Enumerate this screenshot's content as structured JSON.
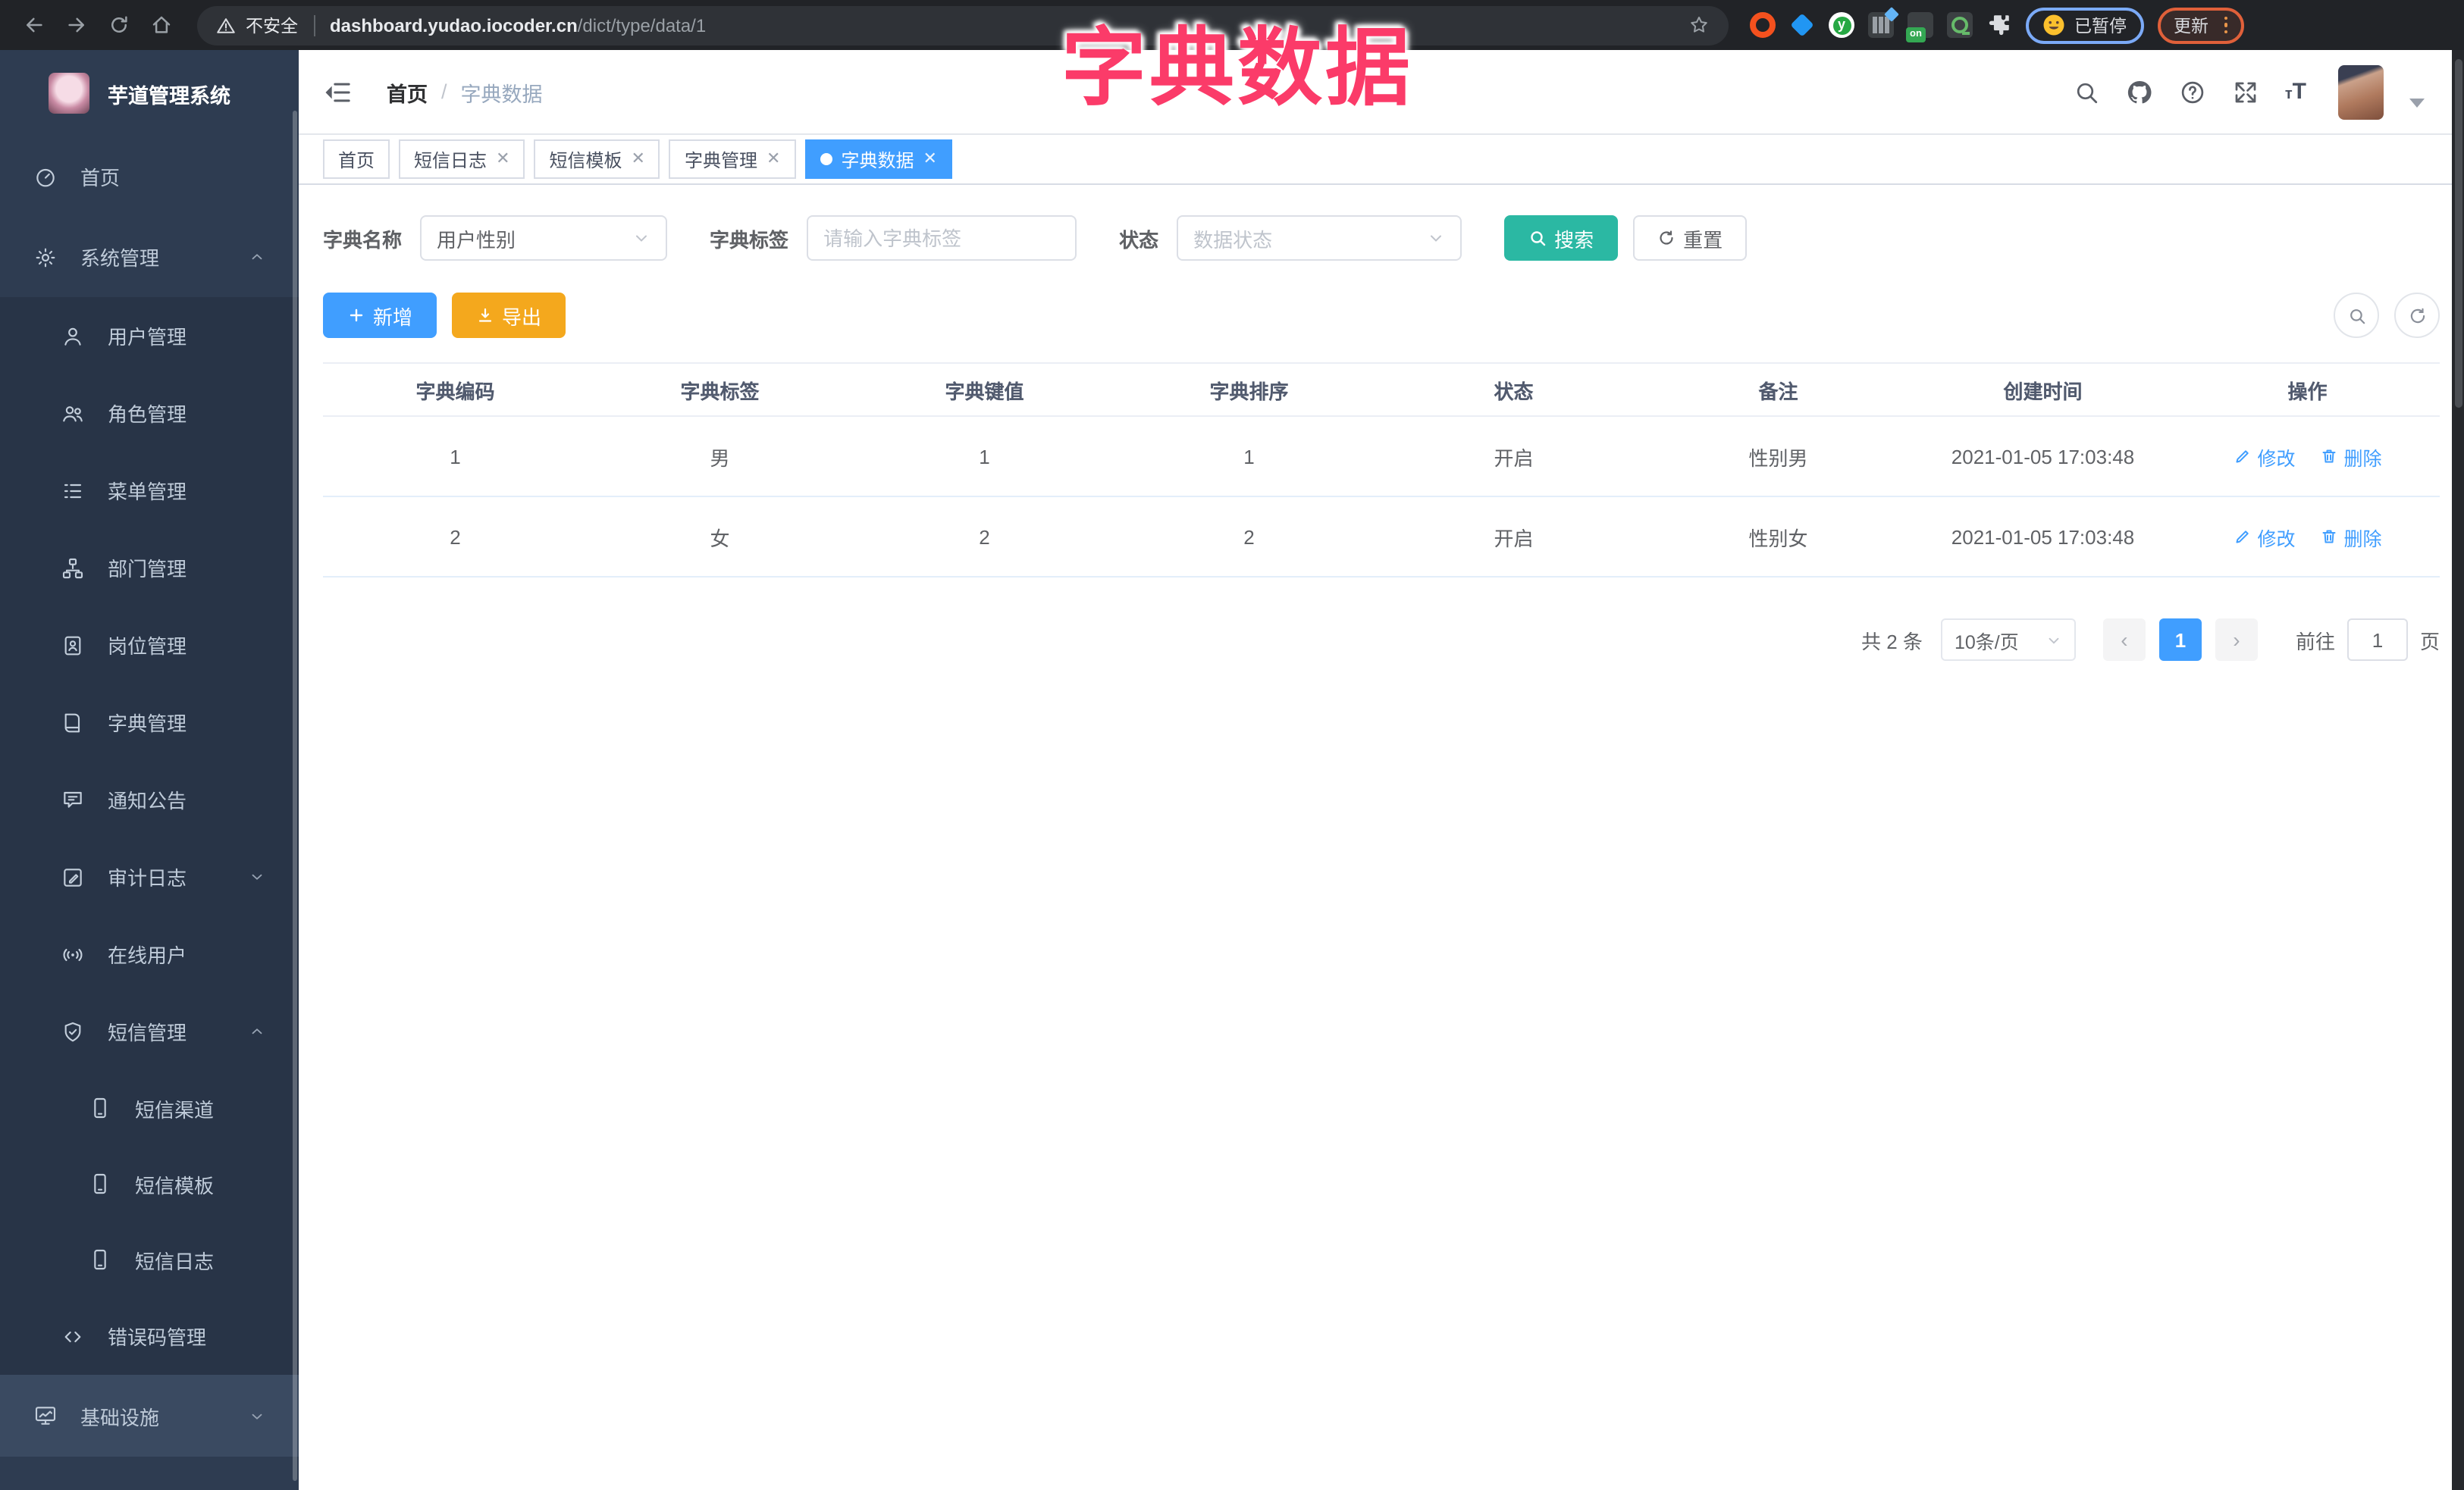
{
  "browser": {
    "security_label": "不安全",
    "url_domain": "dashboard.yudao.iocoder.cn",
    "url_path": "/dict/type/data/1",
    "ext_on_label": "on",
    "paused_label": "已暂停",
    "update_label": "更新"
  },
  "overlay_title": "字典数据",
  "accent_colors": {
    "primary": "#409eff",
    "search_teal": "#2bb8a3",
    "export_orange": "#f4a81d",
    "overlay_pink": "#fb3b69",
    "sidebar_bg": "#2e3c51"
  },
  "sidebar": {
    "app_title": "芋道管理系统",
    "items": [
      {
        "id": "home",
        "label": "首页",
        "icon": "dashboard-icon",
        "level": 0
      },
      {
        "id": "system",
        "label": "系统管理",
        "icon": "gear-icon",
        "level": 0,
        "arrow": "up"
      },
      {
        "id": "user-mgmt",
        "label": "用户管理",
        "icon": "user-icon",
        "level": 1
      },
      {
        "id": "role-mgmt",
        "label": "角色管理",
        "icon": "users-icon",
        "level": 1
      },
      {
        "id": "menu-mgmt",
        "label": "菜单管理",
        "icon": "menu-tree-icon",
        "level": 1
      },
      {
        "id": "dept-mgmt",
        "label": "部门管理",
        "icon": "org-icon",
        "level": 1
      },
      {
        "id": "post-mgmt",
        "label": "岗位管理",
        "icon": "badge-icon",
        "level": 1
      },
      {
        "id": "dict-mgmt",
        "label": "字典管理",
        "icon": "book-icon",
        "level": 1
      },
      {
        "id": "notice",
        "label": "通知公告",
        "icon": "announcement-icon",
        "level": 1
      },
      {
        "id": "audit-log",
        "label": "审计日志",
        "icon": "audit-icon",
        "level": 1,
        "arrow": "down"
      },
      {
        "id": "online-users",
        "label": "在线用户",
        "icon": "online-icon",
        "level": 1
      },
      {
        "id": "sms-mgmt",
        "label": "短信管理",
        "icon": "shield-icon",
        "level": 1,
        "arrow": "up"
      },
      {
        "id": "sms-channel",
        "label": "短信渠道",
        "icon": "phone-icon",
        "level": 2
      },
      {
        "id": "sms-template",
        "label": "短信模板",
        "icon": "phone-icon",
        "level": 2
      },
      {
        "id": "sms-log",
        "label": "短信日志",
        "icon": "phone-icon",
        "level": 2
      },
      {
        "id": "error-code",
        "label": "错误码管理",
        "icon": "code-icon",
        "level": 1
      },
      {
        "id": "infra",
        "label": "基础设施",
        "icon": "infra-icon",
        "level": 0,
        "arrow": "down",
        "alt": true
      }
    ]
  },
  "header": {
    "breadcrumb_home": "首页",
    "breadcrumb_sep": "/",
    "breadcrumb_current": "字典数据"
  },
  "tabs": [
    {
      "label": "首页",
      "closable": false,
      "active": false
    },
    {
      "label": "短信日志",
      "closable": true,
      "active": false
    },
    {
      "label": "短信模板",
      "closable": true,
      "active": false
    },
    {
      "label": "字典管理",
      "closable": true,
      "active": false
    },
    {
      "label": "字典数据",
      "closable": true,
      "active": true
    }
  ],
  "filters": {
    "name_label": "字典名称",
    "name_value": "用户性别",
    "label_label": "字典标签",
    "label_placeholder": "请输入字典标签",
    "status_label": "状态",
    "status_placeholder": "数据状态",
    "search_label": "搜索",
    "reset_label": "重置"
  },
  "toolbar": {
    "add_label": "新增",
    "export_label": "导出"
  },
  "table": {
    "columns": [
      "字典编码",
      "字典标签",
      "字典键值",
      "字典排序",
      "状态",
      "备注",
      "创建时间",
      "操作"
    ],
    "rows": [
      {
        "cells": [
          "1",
          "男",
          "1",
          "1",
          "开启",
          "性别男",
          "2021-01-05 17:03:48"
        ]
      },
      {
        "cells": [
          "2",
          "女",
          "2",
          "2",
          "开启",
          "性别女",
          "2021-01-05 17:03:48"
        ]
      }
    ],
    "edit_label": "修改",
    "delete_label": "删除"
  },
  "pagination": {
    "total_label": "共 2 条",
    "size_label": "10条/页",
    "prev_label": "‹",
    "page": "1",
    "next_label": "›",
    "goto_label": "前往",
    "goto_value": "1",
    "unit_label": "页"
  }
}
